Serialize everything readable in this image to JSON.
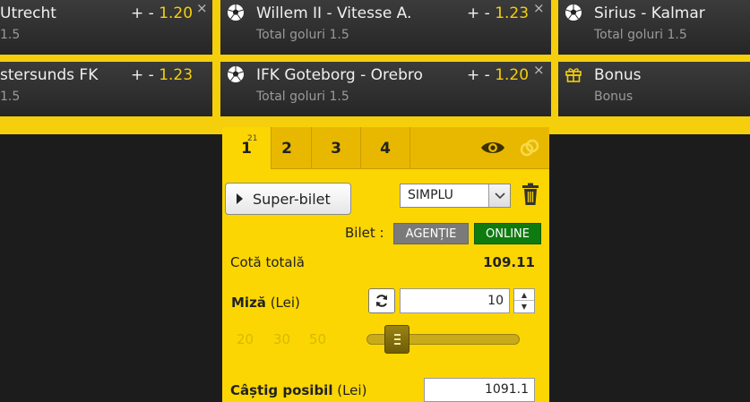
{
  "selections": [
    {
      "title": "Utrecht",
      "subtitle": "1.5",
      "odds_prefix": "+ -",
      "odds": "1.20",
      "close": "×"
    },
    {
      "title": "Willem II - Vitesse A.",
      "subtitle": "Total goluri 1.5",
      "odds_prefix": "+ -",
      "odds": "1.23",
      "close": "×"
    },
    {
      "title": "Sirius - Kalmar",
      "subtitle": "Total goluri 1.5",
      "close": "×"
    },
    {
      "title": "stersunds FK",
      "subtitle": "1.5",
      "odds_prefix": "+ -",
      "odds": "1.23",
      "close": "×"
    },
    {
      "title": "IFK Goteborg - Orebro",
      "subtitle": "Total goluri 1.5",
      "odds_prefix": "+ -",
      "odds": "1.20",
      "close": "×"
    },
    {
      "title": "Bonus",
      "subtitle": "Bonus"
    }
  ],
  "betslip": {
    "tabs": [
      {
        "label": "1",
        "badge": "21"
      },
      {
        "label": "2"
      },
      {
        "label": "3"
      },
      {
        "label": "4"
      }
    ],
    "super_bilet_label": "Super-bilet",
    "bet_type_selected": "SIMPLU",
    "bilet_label": "Bilet :",
    "agentie_label": "AGENȚIE",
    "online_label": "ONLINE",
    "cota_label": "Cotă totală",
    "cota_value": "109.11",
    "miza_label_bold": "Miză",
    "miza_label_unit": " (Lei)",
    "miza_value": "10",
    "quick_amounts": [
      "20",
      "30",
      "50"
    ],
    "stake_slider_level": 0.2,
    "castig_label_bold": "Câștig posibil",
    "castig_label_unit": " (Lei)",
    "castig_value": "1091.1"
  },
  "colors": {
    "accent_yellow": "#f5cf0b",
    "online_green": "#0e7a10",
    "agentie_gray": "#7a7a7a"
  }
}
